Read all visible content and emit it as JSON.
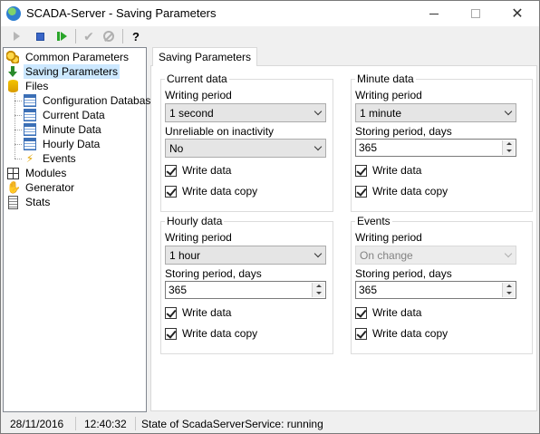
{
  "window": {
    "title": "SCADA-Server - Saving Parameters"
  },
  "toolbar": {
    "buttons": [
      {
        "name": "start-service",
        "icon": "play-icon"
      },
      {
        "name": "stop-service",
        "icon": "stop-icon"
      },
      {
        "name": "restart-service",
        "icon": "restart-icon"
      },
      {
        "name": "apply",
        "icon": "check-icon"
      },
      {
        "name": "cancel",
        "icon": "cancel-icon"
      },
      {
        "name": "help",
        "icon": "help-icon",
        "label": "?"
      }
    ]
  },
  "tree": {
    "items": [
      {
        "label": "Common Parameters",
        "icon": "gears-icon"
      },
      {
        "label": "Saving Parameters",
        "icon": "down-arrow-icon",
        "selected": true
      },
      {
        "label": "Files",
        "icon": "database-icon"
      },
      {
        "label": "Configuration Database",
        "icon": "table-icon"
      },
      {
        "label": "Current Data",
        "icon": "table-icon"
      },
      {
        "label": "Minute Data",
        "icon": "table-icon"
      },
      {
        "label": "Hourly Data",
        "icon": "table-icon"
      },
      {
        "label": "Events",
        "icon": "lightning-icon"
      },
      {
        "label": "Modules",
        "icon": "modules-icon"
      },
      {
        "label": "Generator",
        "icon": "hand-icon"
      },
      {
        "label": "Stats",
        "icon": "stats-icon"
      }
    ]
  },
  "tab": {
    "label": "Saving Parameters"
  },
  "groups": {
    "current": {
      "title": "Current data",
      "writing_period_label": "Writing period",
      "writing_period_value": "1 second",
      "unreliable_label": "Unreliable on inactivity",
      "unreliable_value": "No",
      "write_data": "Write data",
      "write_data_copy": "Write data copy"
    },
    "minute": {
      "title": "Minute data",
      "writing_period_label": "Writing period",
      "writing_period_value": "1 minute",
      "storing_label": "Storing period, days",
      "storing_value": "365",
      "write_data": "Write data",
      "write_data_copy": "Write data copy"
    },
    "hourly": {
      "title": "Hourly data",
      "writing_period_label": "Writing period",
      "writing_period_value": "1 hour",
      "storing_label": "Storing period, days",
      "storing_value": "365",
      "write_data": "Write data",
      "write_data_copy": "Write data copy"
    },
    "events": {
      "title": "Events",
      "writing_period_label": "Writing period",
      "writing_period_value": "On change",
      "storing_label": "Storing period, days",
      "storing_value": "365",
      "write_data": "Write data",
      "write_data_copy": "Write data copy"
    }
  },
  "status": {
    "date": "28/11/2016",
    "time": "12:40:32",
    "state": "State of ScadaServerService: running"
  }
}
